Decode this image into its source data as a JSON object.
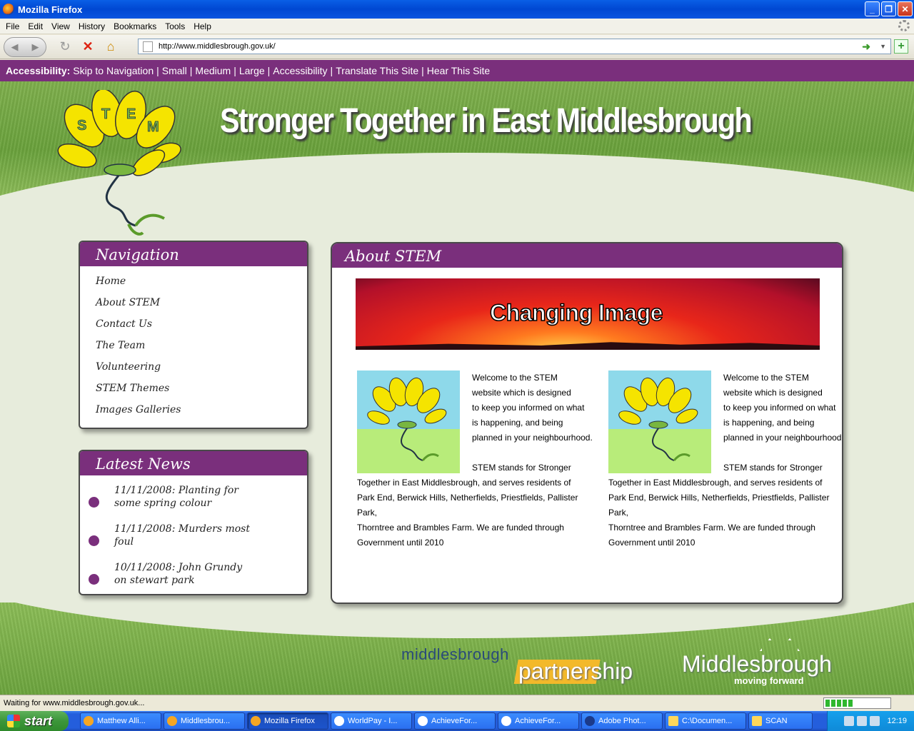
{
  "window": {
    "title": "Mozilla Firefox"
  },
  "menu": [
    "File",
    "Edit",
    "View",
    "History",
    "Bookmarks",
    "Tools",
    "Help"
  ],
  "address": {
    "url": "http://www.middlesbrough.gov.uk/"
  },
  "accessibility": {
    "label": "Accessibility:",
    "links": [
      "Skip to Navigation",
      "Small",
      "Medium",
      "Large",
      "Accessibility",
      "Translate This Site",
      "Hear This Site"
    ]
  },
  "site": {
    "title": "Stronger Together in East Middlesbrough",
    "logo_text": "STEM"
  },
  "navigation": {
    "heading": "Navigation",
    "items": [
      "Home",
      "About STEM",
      "Contact Us",
      "The Team",
      "Volunteering",
      "STEM Themes",
      "Images Galleries"
    ]
  },
  "news": {
    "heading": "Latest News",
    "items": [
      {
        "line1": "11/11/2008: Planting for",
        "line2": "some spring colour"
      },
      {
        "line1": "11/11/2008: Murders most",
        "line2": "foul"
      },
      {
        "line1": "10/11/2008: John Grundy",
        "line2": "on stewart park"
      }
    ]
  },
  "about": {
    "heading": "About STEM",
    "banner_text": "Changing Image",
    "columns": [
      {
        "lines": [
          "Welcome to the STEM",
          "website which is designed",
          "to keep you informed on what",
          "is happening, and being",
          "planned in your neighbourhood.",
          "",
          "STEM stands for Stronger"
        ],
        "rest": [
          "Together in East Middlesbrough, and serves residents of",
          "Park End, Berwick Hills, Netherfields, Priestfields, Pallister Park,",
          "Thorntree and Brambles Farm. We are funded through",
          "Government until 2010"
        ]
      },
      {
        "lines": [
          "Welcome to the STEM",
          "website which is designed",
          "to keep you informed on what",
          "is happening, and being",
          "planned in your neighbourhood.",
          "",
          "STEM stands for Stronger"
        ],
        "rest": [
          "Together in East Middlesbrough, and serves residents of",
          "Park End, Berwick Hills, Netherfields, Priestfields, Pallister Park,",
          "Thorntree and Brambles Farm. We are funded through",
          "Government until 2010"
        ]
      }
    ]
  },
  "footer": {
    "partner_top": "middlesbrough",
    "partner_bottom": "partnership",
    "council_name": "Middlesbrough",
    "council_tagline": "moving forward"
  },
  "status": {
    "text": "Waiting for www.middlesbrough.gov.uk...",
    "progress": 0.45
  },
  "taskbar": {
    "start": "start",
    "tasks": [
      "Matthew Alli...",
      "Middlesbrou...",
      "Mozilla Firefox",
      "WorldPay - I...",
      "AchieveFor...",
      "AchieveFor...",
      "Adobe Phot...",
      "C:\\Documen...",
      "SCAN"
    ],
    "active_index": 2,
    "clock": "12:19"
  },
  "colors": {
    "accent": "#7a2f7c",
    "grass": "#6aa23c"
  }
}
